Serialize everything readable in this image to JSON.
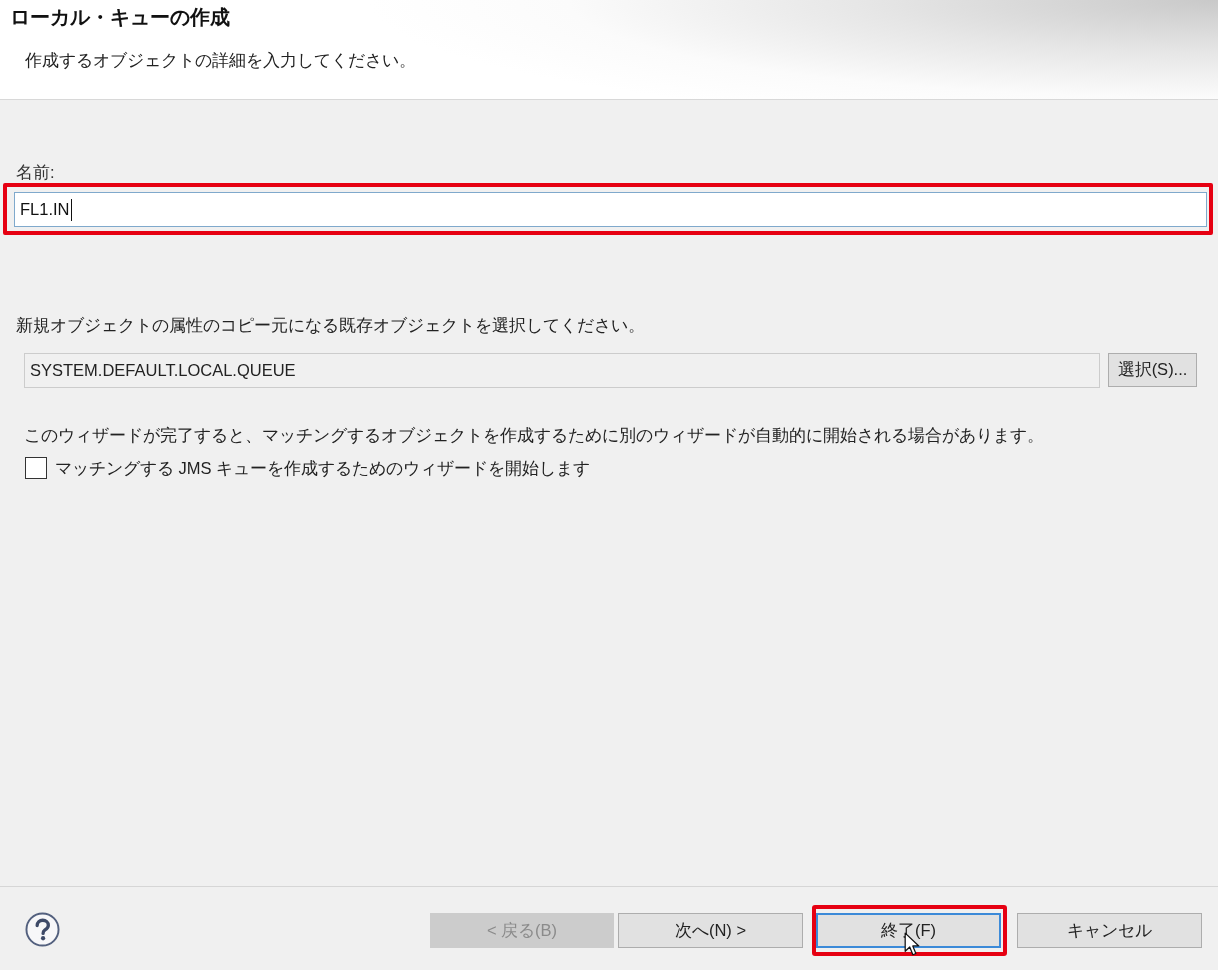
{
  "dialog": {
    "title": "ローカル・キューの作成",
    "description": "作成するオブジェクトの詳細を入力してください。"
  },
  "name_field": {
    "label": "名前:",
    "value": "FL1.IN",
    "focused": true,
    "highlighted": true
  },
  "copy_source": {
    "instruction": "新規オブジェクトの属性のコピー元になる既存オブジェクトを選択してください。",
    "value": "SYSTEM.DEFAULT.LOCAL.QUEUE",
    "button": "選択(S)..."
  },
  "note": "このウィザードが完了すると、マッチングするオブジェクトを作成するために別のウィザードが自動的に開始される場合があります。",
  "checkbox": {
    "label": "マッチングする JMS キューを作成するためのウィザードを開始します",
    "checked": false
  },
  "footer": {
    "buttons": [
      {
        "label": "< 戻る(B)",
        "disabled": true,
        "default": false,
        "highlighted": false,
        "pointer_over": false
      },
      {
        "label": "次へ(N) >",
        "disabled": false,
        "default": false,
        "highlighted": false,
        "pointer_over": false
      },
      {
        "label": "終了(F)",
        "disabled": false,
        "default": true,
        "highlighted": true,
        "pointer_over": true
      },
      {
        "label": "キャンセル",
        "disabled": false,
        "default": false,
        "highlighted": false,
        "pointer_over": false
      }
    ]
  }
}
